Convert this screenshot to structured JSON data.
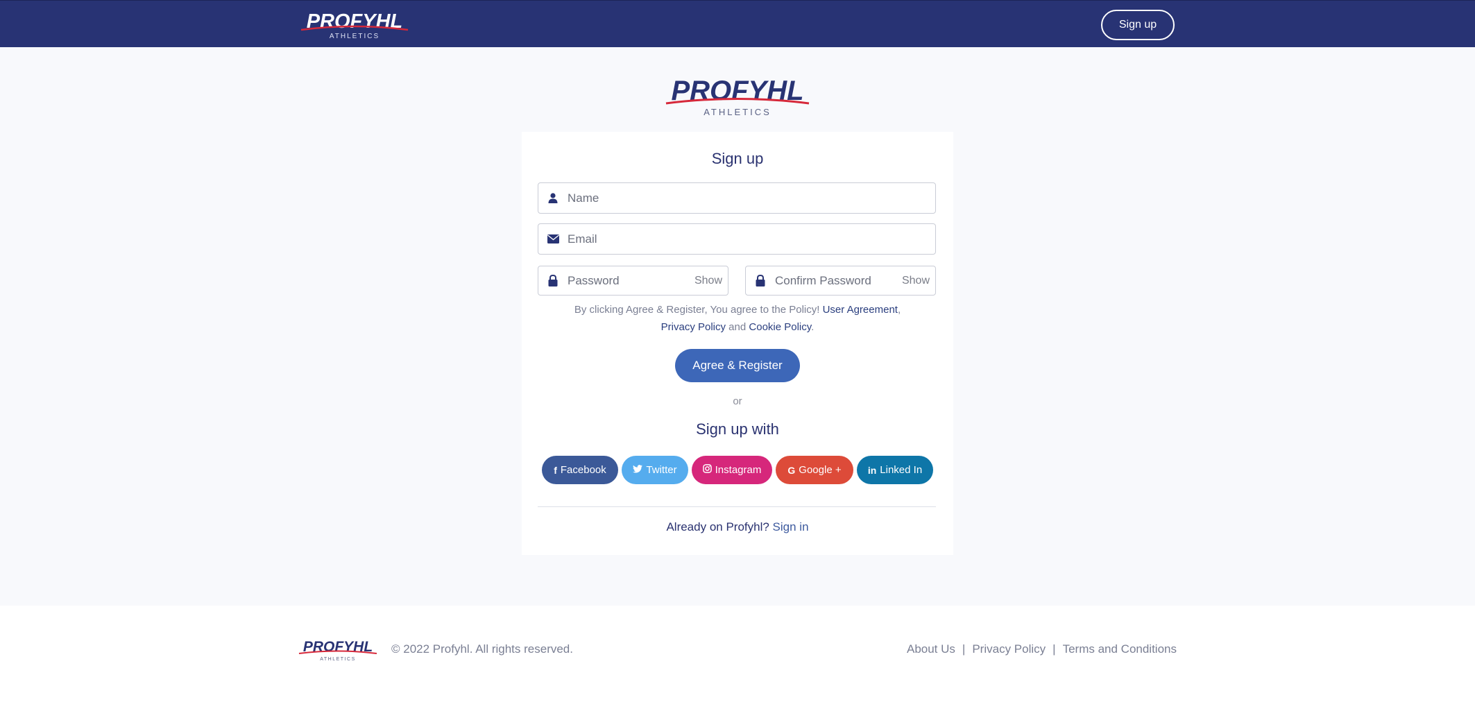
{
  "nav": {
    "logo_text": "PROFYHL",
    "logo_sub": "ATHLETICS",
    "signup_label": "Sign up"
  },
  "main": {
    "logo_text": "PROFYHL",
    "logo_sub": "ATHLETICS"
  },
  "form": {
    "title": "Sign up",
    "name_placeholder": "Name",
    "email_placeholder": "Email",
    "password_placeholder": "Password",
    "confirm_placeholder": "Confirm Password",
    "show_label": "Show",
    "terms_prefix": "By clicking Agree & Register, You agree to the Policy! ",
    "user_agreement": "User Agreement",
    "terms_comma": ",",
    "privacy_policy": "Privacy Policy",
    "terms_and": " and ",
    "cookie_policy": "Cookie Policy",
    "terms_period": ".",
    "register_label": "Agree & Register",
    "or_label": "or",
    "signup_with_title": "Sign up with",
    "already_text": "Already on Profyhl? ",
    "signin_label": "Sign in"
  },
  "socials": [
    {
      "icon": "f",
      "label": "Facebook",
      "color": "#3b5998"
    },
    {
      "icon": "twitter-bird",
      "label": "Twitter",
      "color": "#55acee"
    },
    {
      "icon": "instagram",
      "label": "Instagram",
      "color": "#d6277b"
    },
    {
      "icon": "G",
      "label": "Google +",
      "color": "#dd4b39"
    },
    {
      "icon": "in",
      "label": "Linked In",
      "color": "#0e76a8"
    }
  ],
  "footer": {
    "logo_text": "PROFYHL",
    "logo_sub": "ATHLETICS",
    "copyright": "© 2022 Profyhl. All rights reserved.",
    "about": "About Us",
    "sep": "|",
    "privacy": "Privacy Policy",
    "terms": "Terms and Conditions"
  },
  "colors": {
    "nav_bg": "#283374",
    "brand_navy": "#283374",
    "accent_red": "#d6283a",
    "button_blue": "#3d67b8"
  }
}
